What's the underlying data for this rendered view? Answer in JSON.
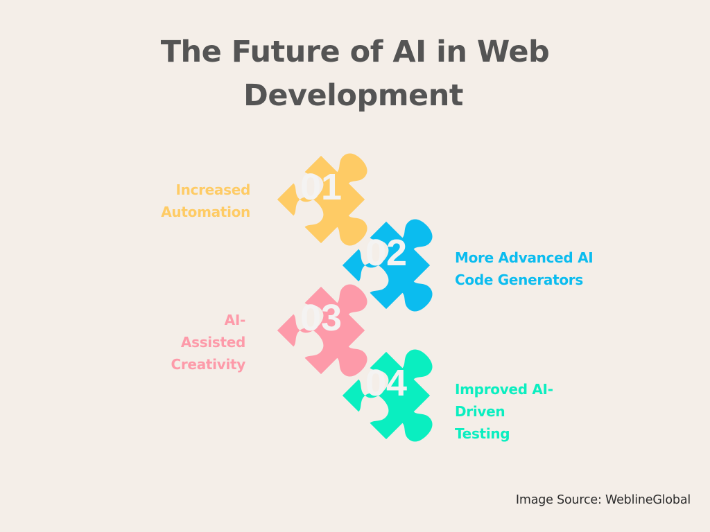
{
  "title": {
    "line1": "The Future of AI in Web",
    "line2": "Development"
  },
  "steps": [
    {
      "number": "01",
      "label_lines": [
        "Increased",
        "Automation"
      ],
      "color": "#fecb65",
      "side": "left"
    },
    {
      "number": "02",
      "label_lines": [
        "More Advanced AI",
        "Code Generators"
      ],
      "color": "#0bbcef",
      "side": "right"
    },
    {
      "number": "03",
      "label_lines": [
        "AI-",
        "Assisted",
        "Creativity"
      ],
      "color": "#fd9aa9",
      "side": "left"
    },
    {
      "number": "04",
      "label_lines": [
        "Improved AI-",
        "Driven",
        "Testing"
      ],
      "color": "#0aeec0",
      "side": "right"
    }
  ],
  "source": "Image Source: WeblineGlobal"
}
